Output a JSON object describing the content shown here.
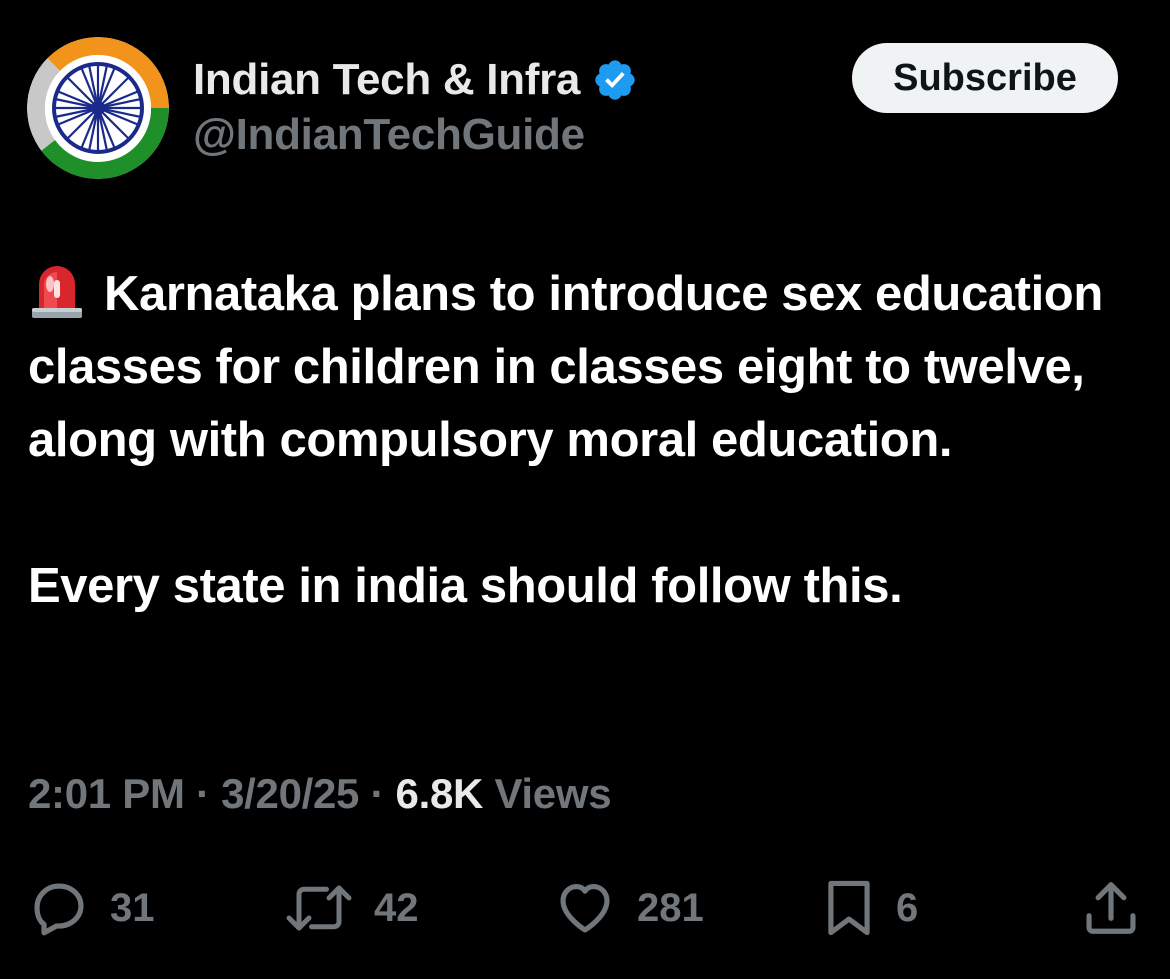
{
  "header": {
    "display_name": "Indian Tech & Infra",
    "handle": "@IndianTechGuide",
    "subscribe_label": "Subscribe"
  },
  "tweet": {
    "paragraphs": [
      "Karnataka plans to introduce sex education classes for children in classes eight to twelve, along with compulsory moral education.",
      "Every state in india should follow this."
    ],
    "leading_icon": "police-siren-icon"
  },
  "meta": {
    "time": "2:01 PM",
    "separator": "·",
    "date": "3/20/25",
    "views_count": "6.8K",
    "views_label": "Views"
  },
  "actions": {
    "replies": "31",
    "reposts": "42",
    "likes": "281",
    "bookmarks": "6"
  },
  "colors": {
    "background": "#000000",
    "text": "#ffffff",
    "secondary": "#71767b",
    "verified": "#1d9bf0",
    "subscribe_bg": "#eff3f4"
  }
}
